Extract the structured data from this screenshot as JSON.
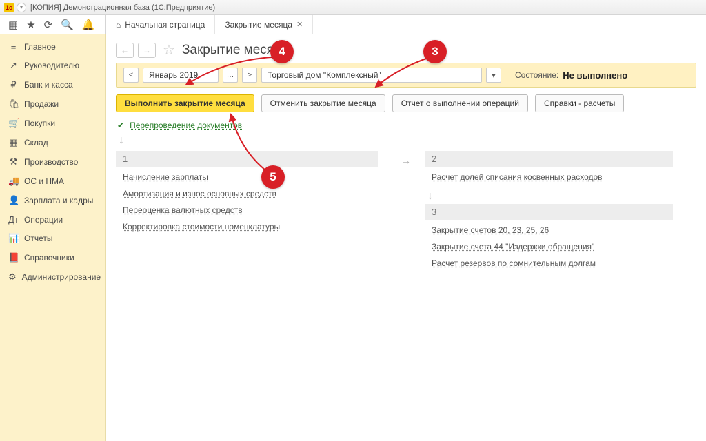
{
  "window": {
    "title": "[КОПИЯ] Демонстрационная база  (1С:Предприятие)"
  },
  "tabs": {
    "home": "Начальная страница",
    "current": "Закрытие месяца"
  },
  "sidebar": {
    "items": [
      {
        "icon": "≡",
        "label": "Главное"
      },
      {
        "icon": "↗",
        "label": "Руководителю"
      },
      {
        "icon": "₽",
        "label": "Банк и касса"
      },
      {
        "icon": "🛍",
        "label": "Продажи"
      },
      {
        "icon": "🛒",
        "label": "Покупки"
      },
      {
        "icon": "▦",
        "label": "Склад"
      },
      {
        "icon": "⚒",
        "label": "Производство"
      },
      {
        "icon": "🚚",
        "label": "ОС и НМА"
      },
      {
        "icon": "👤",
        "label": "Зарплата и кадры"
      },
      {
        "icon": "Дт",
        "label": "Операции"
      },
      {
        "icon": "📊",
        "label": "Отчеты"
      },
      {
        "icon": "📕",
        "label": "Справочники"
      },
      {
        "icon": "⚙",
        "label": "Администрирование"
      }
    ]
  },
  "page": {
    "title": "Закрытие месяца",
    "period": "Январь 2019",
    "org": "Торговый дом \"Комплексный\"",
    "state_label": "Состояние:",
    "state_value": "Не выполнено"
  },
  "buttons": {
    "run": "Выполнить закрытие месяца",
    "cancel": "Отменить закрытие месяца",
    "report": "Отчет о выполнении операций",
    "refs": "Справки - расчеты"
  },
  "reproved_link": "Перепроведение документов",
  "steps": {
    "col1": {
      "num": "1",
      "items": [
        "Начисление зарплаты",
        "Амортизация и износ основных средств",
        "Переоценка валютных средств",
        "Корректировка стоимости номенклатуры"
      ]
    },
    "col2a": {
      "num": "2",
      "items": [
        "Расчет долей списания косвенных расходов"
      ]
    },
    "col2b": {
      "num": "3",
      "items": [
        "Закрытие счетов 20, 23, 25, 26",
        "Закрытие счета 44 \"Издержки обращения\"",
        "Расчет резервов по сомнительным долгам"
      ]
    }
  },
  "callouts": {
    "c3": "3",
    "c4": "4",
    "c5": "5"
  }
}
